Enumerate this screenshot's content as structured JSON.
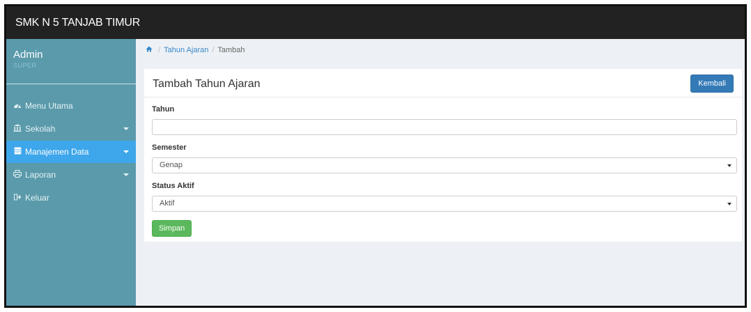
{
  "app": {
    "title": "SMK N 5 TANJAB TIMUR"
  },
  "user": {
    "name": "Admin",
    "role": "SUPER"
  },
  "sidebar": {
    "items": [
      {
        "label": "Menu Utama",
        "icon": "dashboard-icon"
      },
      {
        "label": "Sekolah",
        "icon": "institution-icon"
      },
      {
        "label": "Manajemen Data",
        "icon": "database-icon"
      },
      {
        "label": "Laporan",
        "icon": "print-icon"
      },
      {
        "label": "Keluar",
        "icon": "sign-out-icon"
      }
    ]
  },
  "breadcrumb": {
    "home_icon": "home-icon",
    "items": [
      "Tahun Ajaran",
      "Tambah"
    ]
  },
  "panel": {
    "title": "Tambah Tahun Ajaran",
    "back_label": "Kembali"
  },
  "form": {
    "tahun": {
      "label": "Tahun",
      "value": ""
    },
    "semester": {
      "label": "Semester",
      "selected": "Genap"
    },
    "status": {
      "label": "Status Aktif",
      "selected": "Aktif"
    },
    "save_label": "Simpan"
  },
  "colors": {
    "topbar": "#222222",
    "sidebar": "#5a9aab",
    "active": "#3ea6ea",
    "primary": "#337ab7",
    "success": "#5cb85c"
  }
}
